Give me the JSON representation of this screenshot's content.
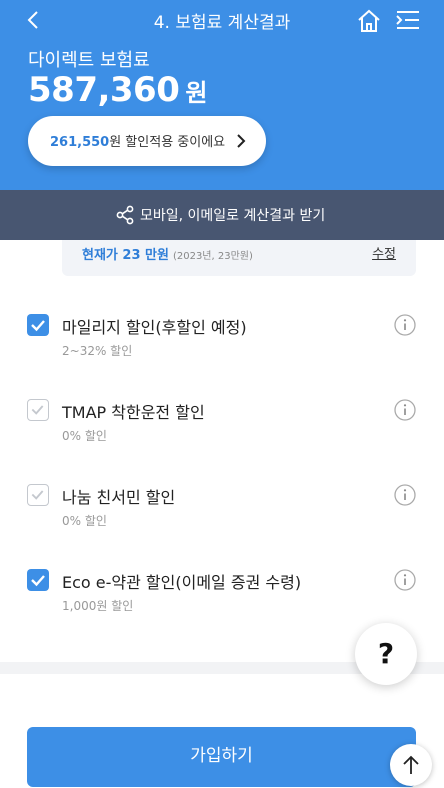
{
  "header": {
    "title": "4. 보험료 계산결과",
    "product_name": "다이렉트 보험료",
    "premium_amount": "587,360",
    "premium_unit": "원",
    "discount_amount": "261,550",
    "discount_text": "원 할인적용 중이에요"
  },
  "share_bar": {
    "label": "모바일, 이메일로 계산결과 받기"
  },
  "mileage_card": {
    "current": "현재가 23 만원",
    "sub": "(2023년, 23만원)",
    "edit_label": "수정"
  },
  "discounts": [
    {
      "name": "마일리지 할인(후할인 예정)",
      "rate": "2~32% 할인",
      "checked": true
    },
    {
      "name": "TMAP 착한운전 할인",
      "rate": "0% 할인",
      "checked": false
    },
    {
      "name": "나눔 친서민 할인",
      "rate": "0% 할인",
      "checked": false
    },
    {
      "name": "Eco e-약관 할인(이메일 증권 수령)",
      "rate": "1,000원 할인",
      "checked": true
    }
  ],
  "help_fab": {
    "label": "?"
  },
  "join_button": {
    "label": "가입하기"
  },
  "colors": {
    "brand": "#3d8fe6",
    "share_bar": "#485671",
    "accent_text": "#2f7ed8"
  }
}
